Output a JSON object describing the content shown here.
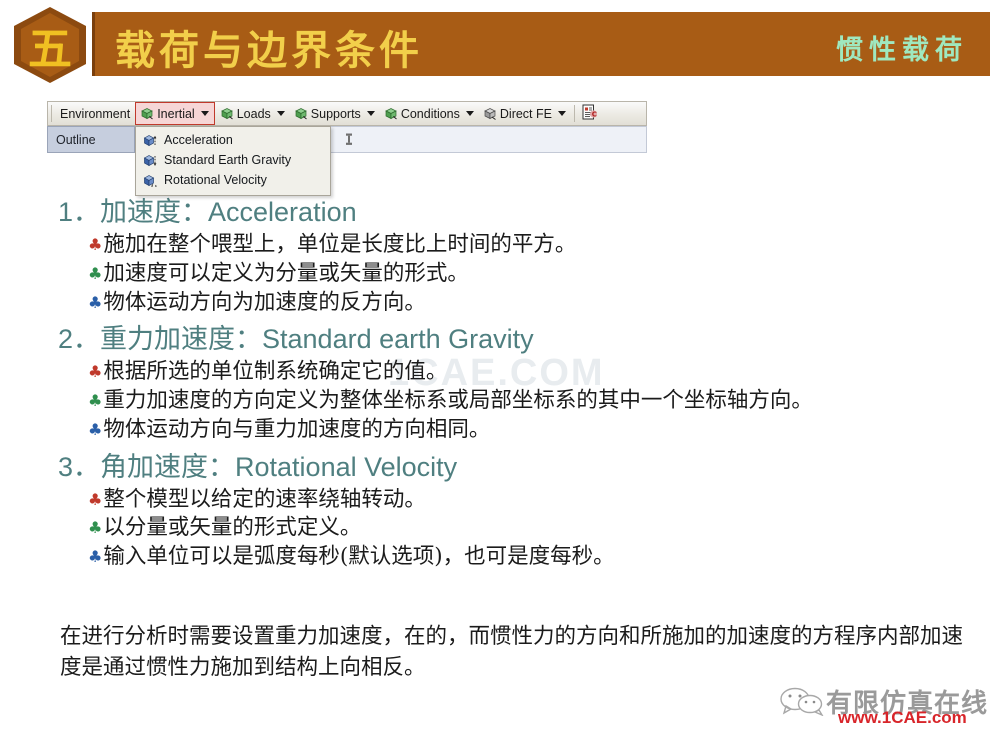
{
  "header": {
    "badge_number": "五",
    "title_main": "载荷与边界条件",
    "title_right": "惯性载荷",
    "colors": {
      "banner_bg": "#a85c15",
      "badge_bg": "#8c4a10",
      "title_text": "#f2cf4a",
      "title_right_text": "#9fe8bf"
    }
  },
  "ansys_toolbar": {
    "items": [
      {
        "label": "Environment",
        "icon": "",
        "has_caret": false
      },
      {
        "label": "Inertial",
        "icon": "green-cube-icon",
        "has_caret": true,
        "highlighted": true
      },
      {
        "label": "Loads",
        "icon": "green-cube-icon",
        "has_caret": true
      },
      {
        "label": "Supports",
        "icon": "green-cube-icon",
        "has_caret": true
      },
      {
        "label": "Conditions",
        "icon": "green-cube-icon",
        "has_caret": true
      },
      {
        "label": "Direct FE",
        "icon": "gray-cube-icon",
        "has_caret": true
      }
    ],
    "end_icon": "document-c-icon",
    "outline_tab_label": "Outline",
    "pin_icon": "pin-icon",
    "dropdown": {
      "items": [
        {
          "label": "Acceleration",
          "icon": "blue-cube-up-icon"
        },
        {
          "label": "Standard Earth Gravity",
          "icon": "blue-cube-down-icon"
        },
        {
          "label": "Rotational Velocity",
          "icon": "blue-cube-rotate-icon"
        }
      ]
    }
  },
  "sections": [
    {
      "heading": "1．加速度：Acceleration",
      "bullets": [
        {
          "color": "red",
          "glyph": "♣",
          "text": "施加在整个喂型上，单位是长度比上时间的平方。"
        },
        {
          "color": "green",
          "glyph": "♣",
          "text": "加速度可以定义为分量或矢量的形式。"
        },
        {
          "color": "blue",
          "glyph": "♣",
          "text": "物体运动方向为加速度的反方向。"
        }
      ]
    },
    {
      "heading": "2．重力加速度：Standard earth Gravity",
      "bullets": [
        {
          "color": "red",
          "glyph": "♣",
          "text": "根据所选的单位制系统确定它的值。"
        },
        {
          "color": "green",
          "glyph": "♣",
          "text": "重力加速度的方向定义为整体坐标系或局部坐标系的其中一个坐标轴方向。"
        },
        {
          "color": "blue",
          "glyph": "♣",
          "text": "物体运动方向与重力加速度的方向相同。"
        }
      ]
    },
    {
      "heading": "3．角加速度：Rotational Velocity",
      "bullets": [
        {
          "color": "red",
          "glyph": "♣",
          "text": "整个模型以给定的速率绕轴转动。"
        },
        {
          "color": "green",
          "glyph": "♣",
          "text": "以分量或矢量的形式定义。"
        },
        {
          "color": "blue",
          "glyph": "♣",
          "text": "输入单位可以是弧度每秒(默认选项)，也可是度每秒。"
        }
      ]
    }
  ],
  "bottom_paragraph": "在进行分析时需要设置重力加速度，在的，而惯性力的方向和所施加的加速度的方程序内部加速度是通过惯性力施加到结构上向相反。",
  "watermarks": {
    "center": "1CAE.COM",
    "bottom_right_cn": "有限仿真在线",
    "bottom_right_url": "www.1CAE.com",
    "bottom_right_icon": "wechat-icon"
  }
}
